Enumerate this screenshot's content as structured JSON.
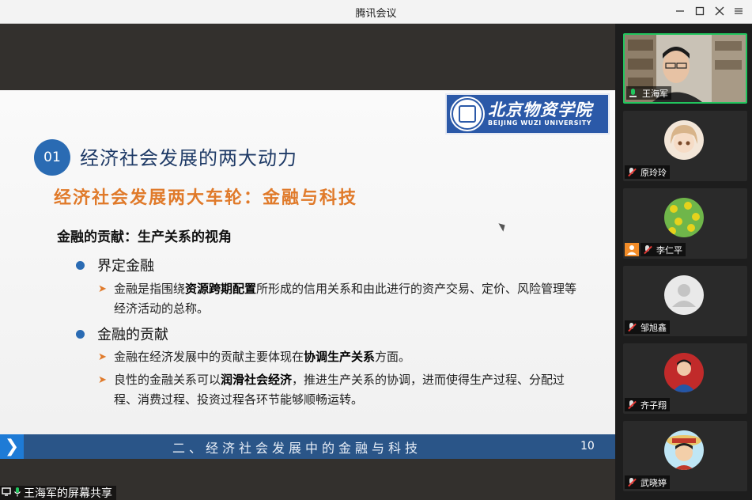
{
  "window": {
    "title": "腾讯会议"
  },
  "slide": {
    "logo": {
      "name_cn": "北京物资学院",
      "name_en": "BEIJING WUZI UNIVERSITY"
    },
    "number": "01",
    "heading": "经济社会发展的两大动力",
    "subheading": "经济社会发展两大车轮：金融与科技",
    "section": "金融的贡献：生产关系的视角",
    "bullets": [
      {
        "label": "界定金融",
        "items": [
          {
            "pre": "金融是指围绕",
            "bold": "资源跨期配置",
            "post": "所形成的信用关系和由此进行的资产交易、定价、风险管理等经济活动的总称。"
          }
        ]
      },
      {
        "label": "金融的贡献",
        "items": [
          {
            "pre": "金融在经济发展中的贡献主要体现在",
            "bold": "协调生产关系",
            "post": "方面。"
          },
          {
            "pre": "良性的金融关系可以",
            "bold": "润滑社会经济",
            "post": "，推进生产关系的协调，进而使得生产过程、分配过程、消费过程、投资过程各环节能够顺畅运转。"
          }
        ]
      }
    ],
    "footer_text": "二、经济社会发展中的金融与科技",
    "page_number": "10"
  },
  "share_label": "王海军的屏幕共享",
  "participants": [
    {
      "name": "王海军",
      "mic": "on",
      "active": true
    },
    {
      "name": "原玲玲",
      "mic": "muted"
    },
    {
      "name": "李仁平",
      "mic": "muted"
    },
    {
      "name": "邹旭鑫",
      "mic": "muted"
    },
    {
      "name": "齐子翔",
      "mic": "muted"
    },
    {
      "name": "武晓婷",
      "mic": "muted"
    }
  ],
  "colors": {
    "accent": "#2a6bb3",
    "orange": "#e07a2a",
    "speaking": "#22c55e",
    "muted": "#e53935"
  }
}
